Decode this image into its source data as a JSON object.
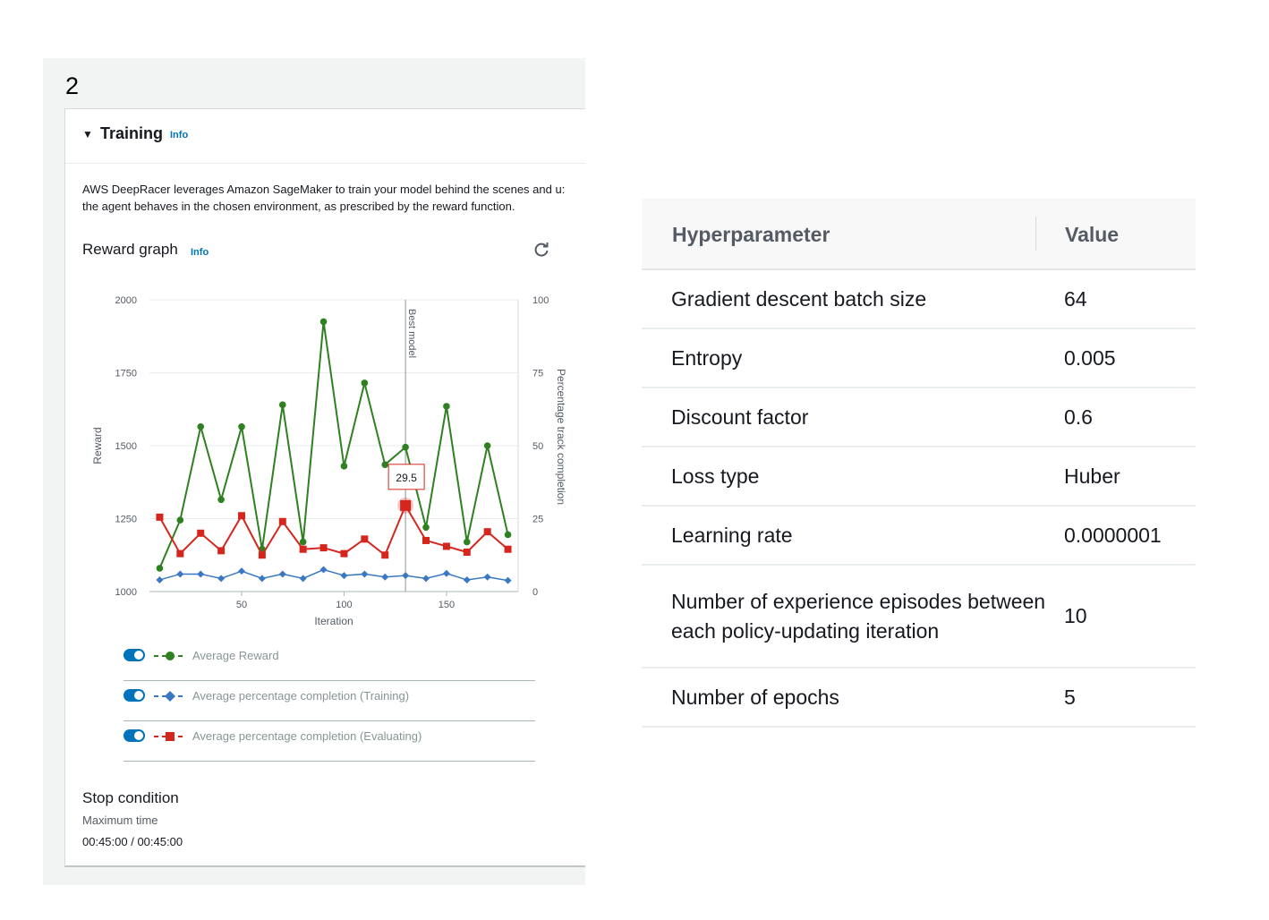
{
  "step_number": "2",
  "training": {
    "title": "Training",
    "info_label": "Info",
    "description_line1": "AWS DeepRacer leverages Amazon SageMaker to train your model behind the scenes and u:",
    "description_line2": "the agent behaves in the chosen environment, as prescribed by the reward function."
  },
  "reward_graph": {
    "title": "Reward graph",
    "info_label": "Info",
    "refresh_icon": "refresh-icon"
  },
  "chart_data": {
    "type": "line",
    "xlabel": "Iteration",
    "ylabel": "Reward",
    "y2label": "Percentage track completion",
    "xlim": [
      5,
      185
    ],
    "ylim": [
      1000,
      2000
    ],
    "y2lim": [
      0,
      100
    ],
    "x_ticks": [
      50,
      100,
      150
    ],
    "y_ticks": [
      1000,
      1250,
      1500,
      1750,
      2000
    ],
    "y2_ticks": [
      0,
      25,
      50,
      75,
      100
    ],
    "x": [
      10,
      20,
      30,
      40,
      50,
      60,
      70,
      80,
      90,
      100,
      110,
      120,
      130,
      140,
      150,
      160,
      170,
      180
    ],
    "series": [
      {
        "name": "Average Reward",
        "axis": "left",
        "color": "#2e8020",
        "marker": "circle",
        "values": [
          1080,
          1245,
          1565,
          1315,
          1565,
          1145,
          1640,
          1170,
          1925,
          1430,
          1715,
          1435,
          1495,
          1220,
          1635,
          1170,
          1500,
          1195
        ]
      },
      {
        "name": "Average percentage completion (Training)",
        "axis": "right",
        "color": "#3b78c3",
        "marker": "diamond",
        "values": [
          4,
          6,
          6,
          4.5,
          7,
          4.5,
          6,
          4.5,
          7.5,
          5.5,
          6,
          5,
          5.5,
          4.5,
          6.2,
          4,
          5,
          3.8
        ]
      },
      {
        "name": "Average percentage completion (Evaluating)",
        "axis": "right",
        "color": "#d5261e",
        "marker": "square",
        "values": [
          25.5,
          13,
          20,
          14,
          26,
          12.5,
          24,
          14.5,
          15,
          13,
          18,
          12.5,
          29.5,
          17.5,
          15.5,
          13.5,
          20.5,
          14.5
        ]
      }
    ],
    "annotations": [
      {
        "type": "vertical_line",
        "x": 130,
        "label": "Best model"
      },
      {
        "type": "tooltip",
        "x": 130,
        "series": "Average percentage completion (Evaluating)",
        "label": "29.5"
      }
    ]
  },
  "legend": [
    {
      "label": "Average Reward",
      "color": "#2e8020",
      "marker": "circle",
      "enabled": true
    },
    {
      "label": "Average percentage completion (Training)",
      "color": "#3b78c3",
      "marker": "diamond",
      "enabled": true
    },
    {
      "label": "Average percentage completion (Evaluating)",
      "color": "#d5261e",
      "marker": "square",
      "enabled": true
    }
  ],
  "stop_condition": {
    "title": "Stop condition",
    "label": "Maximum time",
    "value": "00:45:00 / 00:45:00"
  },
  "hyperparameters": {
    "header_name": "Hyperparameter",
    "header_value": "Value",
    "rows": [
      {
        "name": "Gradient descent batch size",
        "value": "64"
      },
      {
        "name": "Entropy",
        "value": "0.005"
      },
      {
        "name": "Discount factor",
        "value": "0.6"
      },
      {
        "name": "Loss type",
        "value": "Huber"
      },
      {
        "name": "Learning rate",
        "value": "0.0000001"
      },
      {
        "name": "Number of experience episodes between each policy-updating iteration",
        "value": "10"
      },
      {
        "name": "Number of epochs",
        "value": "5"
      }
    ]
  }
}
